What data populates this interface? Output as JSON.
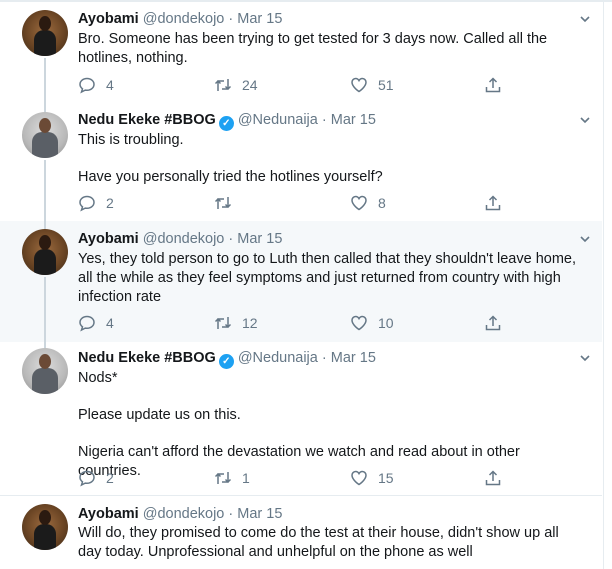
{
  "tweets": [
    {
      "name": "Ayobami",
      "handle": "@dondekojo",
      "date": "Mar 15",
      "verified": false,
      "text": [
        "Bro. Someone has been trying to get tested for 3 days now. Called all the hotlines, nothing."
      ],
      "replies": "4",
      "retweets": "24",
      "likes": "51"
    },
    {
      "name": "Nedu Ekeke #BBOG",
      "handle": "@Nedunaija",
      "date": "Mar 15",
      "verified": true,
      "text": [
        "This is troubling.",
        "Have you personally tried the hotlines yourself?"
      ],
      "replies": "2",
      "retweets": "",
      "likes": "8"
    },
    {
      "name": "Ayobami",
      "handle": "@dondekojo",
      "date": "Mar 15",
      "verified": false,
      "text": [
        "Yes, they told person to go to Luth then called that they shouldn't leave home, all the while as they feel symptoms and just returned from country with high infection rate"
      ],
      "replies": "4",
      "retweets": "12",
      "likes": "10"
    },
    {
      "name": "Nedu Ekeke #BBOG",
      "handle": "@Nedunaija",
      "date": "Mar 15",
      "verified": true,
      "text": [
        "Nods*",
        "Please update us on this.",
        "Nigeria can't afford the devastation we watch and read about in other countries."
      ],
      "replies": "2",
      "retweets": "1",
      "likes": "15"
    },
    {
      "name": "Ayobami",
      "handle": "@dondekojo",
      "date": "Mar 15",
      "verified": false,
      "text": [
        "Will do, they promised to come do the test at their house, didn't show up all day today. Unprofessional and unhelpful on the phone as well"
      ]
    }
  ],
  "separator": "·",
  "colors": {
    "accent": "#1da1f2",
    "muted": "#657786",
    "text": "#14171a",
    "thread_line": "#ccd6dd"
  }
}
